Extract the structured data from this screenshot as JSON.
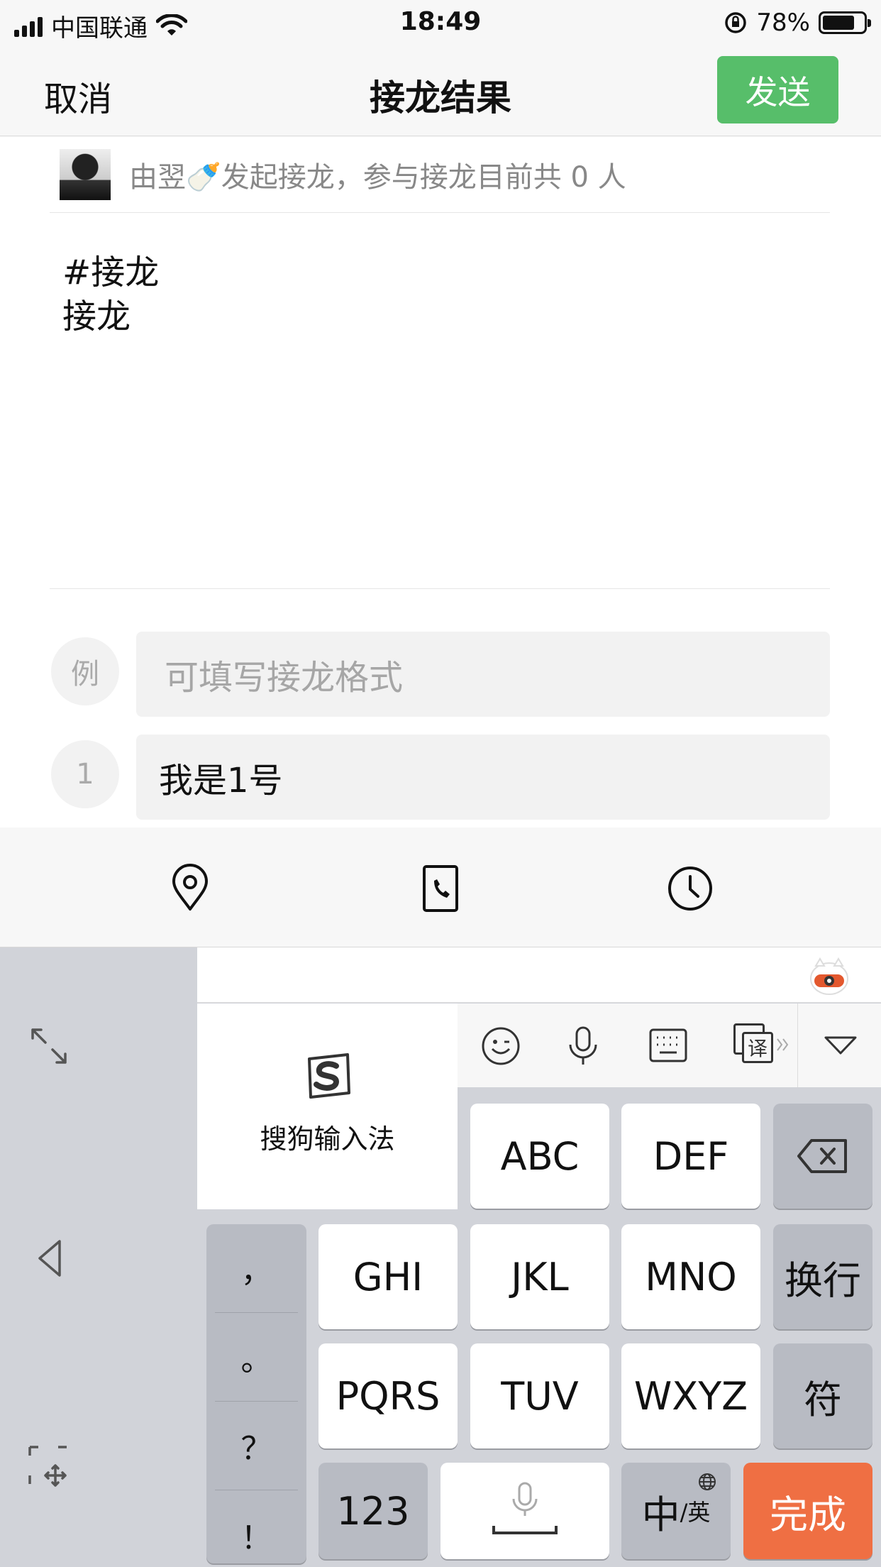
{
  "status_bar": {
    "carrier": "中国联通",
    "time": "18:49",
    "battery": "78%",
    "battery_level": 0.78
  },
  "nav": {
    "cancel": "取消",
    "title": "接龙结果",
    "send": "发送"
  },
  "initiator": {
    "text": "由翌🍼发起接龙，参与接龙目前共 0 人"
  },
  "topic": {
    "line1": "#接龙",
    "line2": "接龙"
  },
  "example_row": {
    "label": "例",
    "placeholder": "可填写接龙格式"
  },
  "entries": [
    {
      "num": "1",
      "value": "我是1号"
    }
  ],
  "toolbar": {
    "icons": [
      "location-pin-icon",
      "phone-icon",
      "clock-icon"
    ]
  },
  "keyboard": {
    "brand": "搜狗输入法",
    "func_icons": [
      "emoji-icon",
      "microphone-icon",
      "keyboard-icon",
      "translate-icon",
      "collapse-icon"
    ],
    "keys_row1": [
      "ABC",
      "DEF"
    ],
    "keys_row2": [
      "GHI",
      "JKL",
      "MNO"
    ],
    "keys_row3": [
      "PQRS",
      "TUV",
      "WXYZ"
    ],
    "newline": "换行",
    "symbols": "符",
    "numbers": "123",
    "lang_main": "中",
    "lang_sub": "/英",
    "done": "完成",
    "punctuation": [
      "，",
      "。",
      "？",
      "！"
    ],
    "translate_glyph": "译",
    "colors": {
      "accent_send": "#57be6a",
      "accent_done": "#ef6f43"
    }
  }
}
